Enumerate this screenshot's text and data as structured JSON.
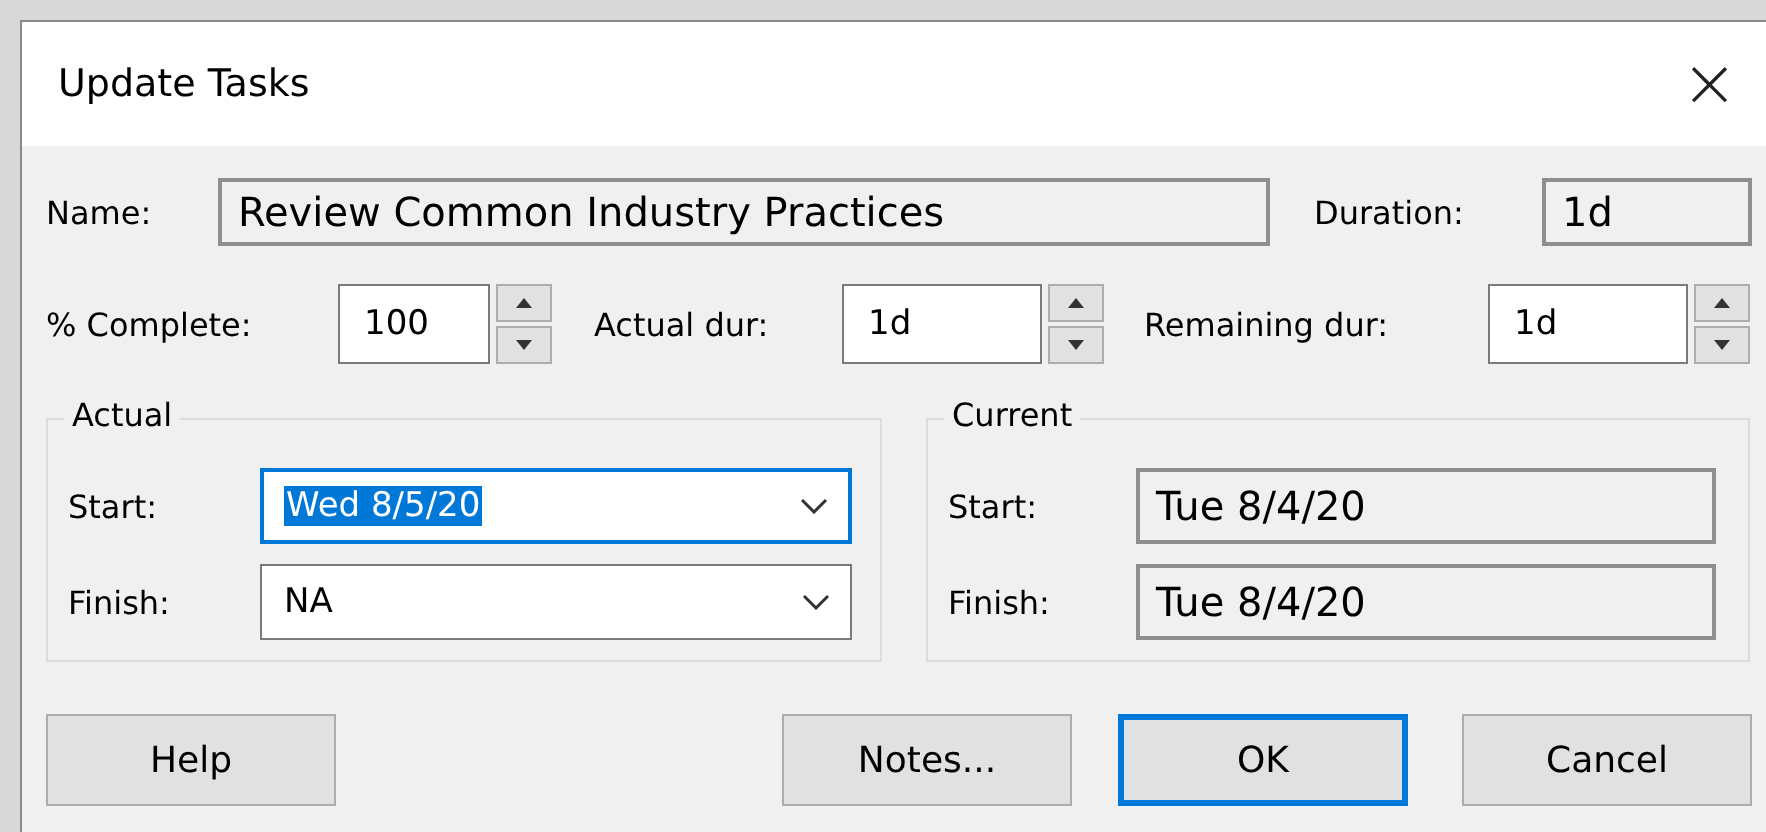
{
  "window": {
    "title": "Update Tasks",
    "close": "×"
  },
  "name": {
    "label": "Name:",
    "value": "Review Common Industry Practices"
  },
  "duration": {
    "label": "Duration:",
    "value": "1d"
  },
  "spinners": [
    {
      "label": "% Complete:",
      "value": "100"
    },
    {
      "label": "Actual dur:",
      "value": "1d"
    },
    {
      "label": "Remaining dur:",
      "value": "1d"
    }
  ],
  "groups": [
    {
      "title": "Actual",
      "kind": "editable",
      "rows": [
        {
          "label": "Start:",
          "value": "Wed 8/5/20",
          "text_selected": true
        },
        {
          "label": "Finish:",
          "value": "NA",
          "text_selected": false
        }
      ]
    },
    {
      "title": "Current",
      "kind": "readonly",
      "rows": [
        {
          "label": "Start:",
          "value": "Tue 8/4/20"
        },
        {
          "label": "Finish:",
          "value": "Tue 8/4/20"
        }
      ]
    }
  ],
  "buttons": [
    {
      "label": "Help",
      "default": false
    },
    {
      "label": "Notes...",
      "default": false
    },
    {
      "label": "OK",
      "default": true
    },
    {
      "label": "Cancel",
      "default": false
    }
  ]
}
